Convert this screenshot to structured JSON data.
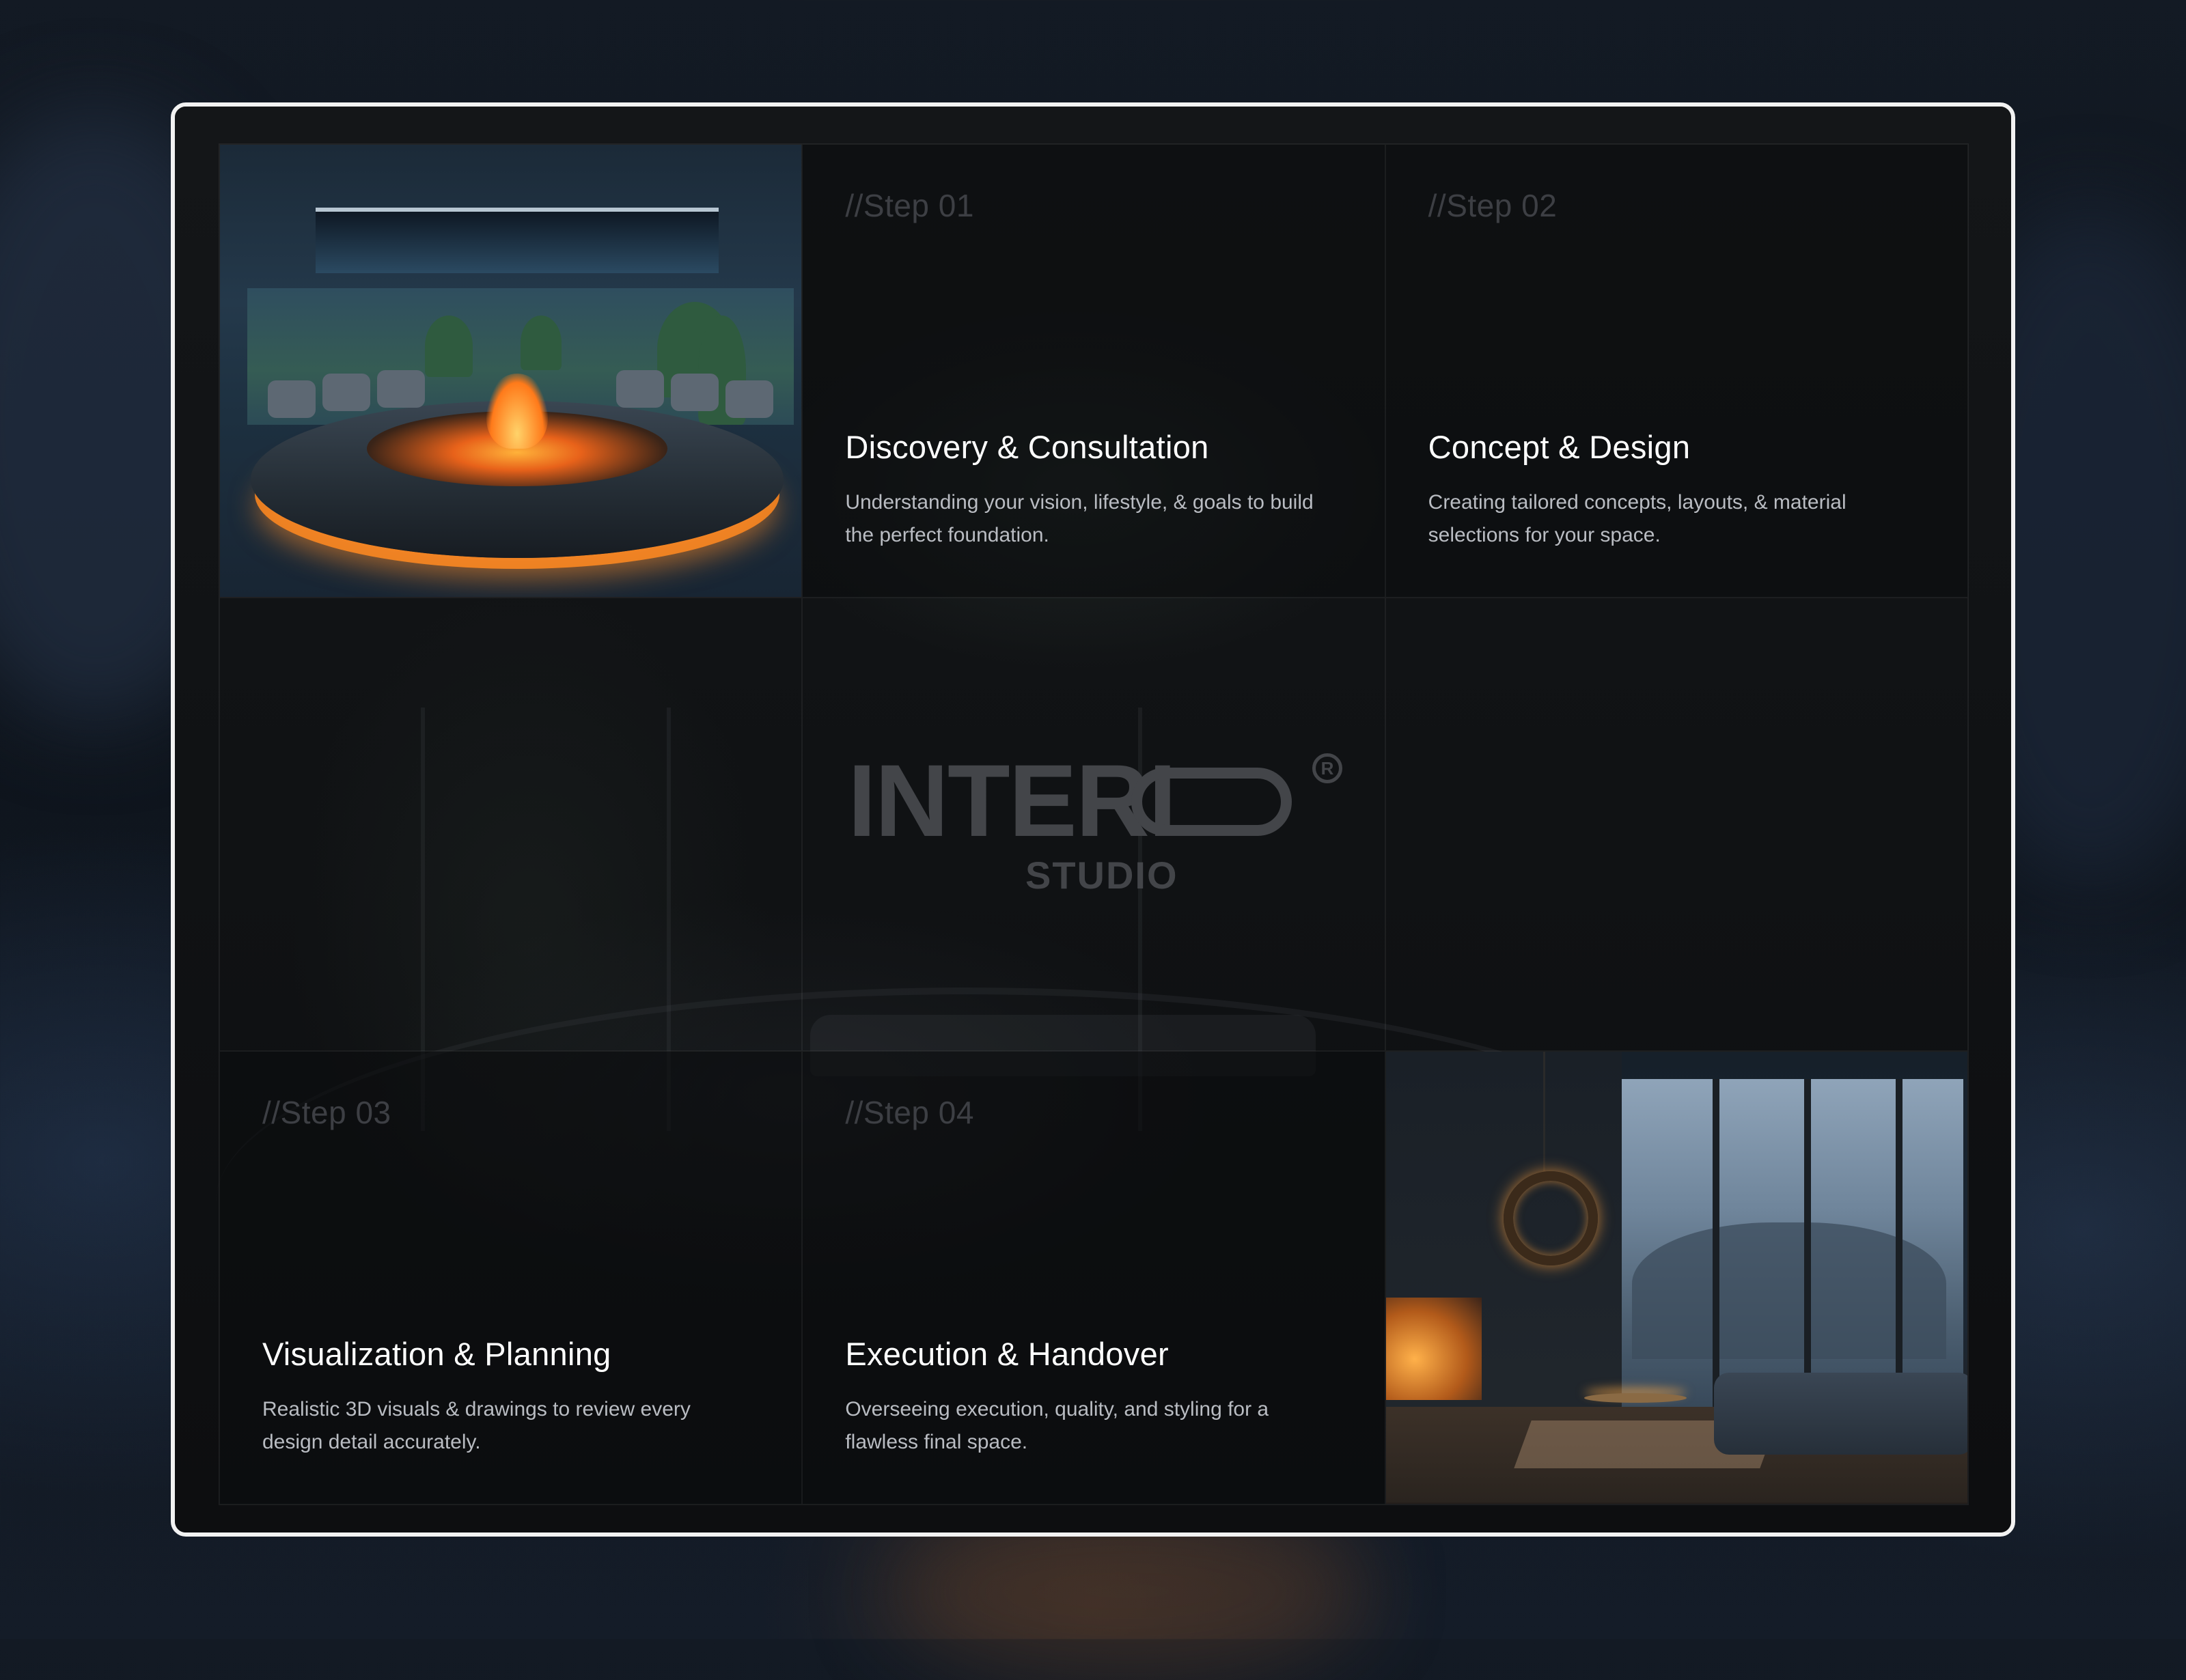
{
  "steps": [
    {
      "label": "//Step 01",
      "title": "Discovery & Consultation",
      "description": "Understanding your vision, lifestyle, & goals to build the perfect foundation."
    },
    {
      "label": "//Step 02",
      "title": "Concept & Design",
      "description": "Creating tailored concepts, layouts, & material selections for your space."
    },
    {
      "label": "//Step 03",
      "title": "Visualization & Planning",
      "description": "Realistic 3D visuals & drawings to review every design detail accurately."
    },
    {
      "label": "//Step 04",
      "title": "Execution & Handover",
      "description": "Overseeing execution, quality, and styling for a flawless final space."
    }
  ],
  "logo": {
    "word": "INTERI",
    "subtitle": "STUDIO",
    "registered": "R"
  },
  "photos": {
    "top_left": "fire-pit-lounge",
    "bottom_right": "living-room-fireplace"
  },
  "colors": {
    "frame_border": "#f2f2f2",
    "panel_background": "#0b0c0e",
    "step_label": "#3d3f44",
    "title_text": "#ffffff",
    "description_text": "#b9bcc2",
    "logo": "#434549",
    "fire_accent": "#e07a20"
  }
}
